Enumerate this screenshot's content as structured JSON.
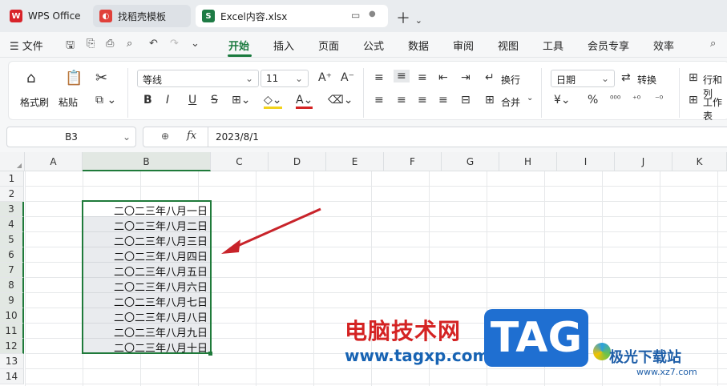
{
  "tabs": [
    {
      "label": "WPS Office",
      "icon": "wps-logo-icon",
      "color": "#d8232a"
    },
    {
      "label": "找稻壳模板",
      "icon": "docer-icon",
      "color": "#e0403a"
    },
    {
      "label": "Excel内容.xlsx",
      "icon": "spreadsheet-icon",
      "color": "#1e7b45"
    }
  ],
  "menu": {
    "file": "文件",
    "items": [
      "开始",
      "插入",
      "页面",
      "公式",
      "数据",
      "审阅",
      "视图",
      "工具",
      "会员专享",
      "效率"
    ],
    "active": "开始"
  },
  "ribbon": {
    "format_painter": "格式刷",
    "paste": "粘贴",
    "font_name": "等线",
    "font_size": "11",
    "wrap": "换行",
    "merge": "合并",
    "number_format": "日期",
    "convert": "转换",
    "rows_cols": "行和列",
    "worksheet": "工作表",
    "bold": "B",
    "italic": "I",
    "underline": "U",
    "strike": "S",
    "currency": "¥",
    "percent": "%"
  },
  "formula_bar": {
    "cell_ref": "B3",
    "fx": "fx",
    "value": "2023/8/1"
  },
  "columns": [
    "A",
    "B",
    "C",
    "D",
    "E",
    "F",
    "G",
    "H",
    "I",
    "J",
    "K"
  ],
  "rows": [
    "1",
    "2",
    "3",
    "4",
    "5",
    "6",
    "7",
    "8",
    "9",
    "10",
    "11",
    "12",
    "13",
    "14"
  ],
  "cells_b": [
    "二〇二三年八月一日",
    "二〇二三年八月二日",
    "二〇二三年八月三日",
    "二〇二三年八月四日",
    "二〇二三年八月五日",
    "二〇二三年八月六日",
    "二〇二三年八月七日",
    "二〇二三年八月八日",
    "二〇二三年八月九日",
    "二〇二三年八月十日"
  ],
  "watermark": {
    "site_cn": "电脑技术网",
    "site_url": "www.tagxp.com",
    "tag": "TAG",
    "brand": "极光下载站",
    "brand_url": "www.xz7.com"
  },
  "colors": {
    "accent": "#1a7a3e",
    "selection": "#1f7a3a",
    "arrow": "#c8232a"
  }
}
